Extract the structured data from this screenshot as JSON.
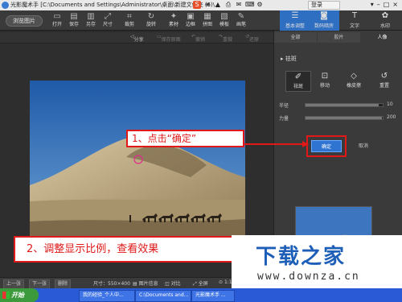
{
  "window": {
    "title": "光影魔术手  [C:\\Documents and Settings\\Administrator\\桌面\\新建文件夹 (6)\\...",
    "login_label": "登录"
  },
  "toolbar": {
    "browse_label": "浏览图片",
    "tools": [
      {
        "label": "打开",
        "icon": "folder-icon"
      },
      {
        "label": "保存",
        "icon": "save-icon"
      },
      {
        "label": "另存",
        "icon": "save-as-icon"
      },
      {
        "label": "尺寸",
        "icon": "resize-icon"
      },
      {
        "label": "裁剪",
        "icon": "crop-icon"
      },
      {
        "label": "旋转",
        "icon": "rotate-icon"
      },
      {
        "label": "素材",
        "icon": "material-icon"
      },
      {
        "label": "边框",
        "icon": "frame-icon"
      },
      {
        "label": "拼图",
        "icon": "collage-icon"
      },
      {
        "label": "模板",
        "icon": "template-icon"
      },
      {
        "label": "画笔",
        "icon": "brush-icon"
      }
    ],
    "right_tabs": [
      {
        "label": "基本调整",
        "icon": "adjust-icon"
      },
      {
        "label": "数码暗房",
        "icon": "camera-icon"
      },
      {
        "label": "文字",
        "icon": "text-icon"
      },
      {
        "label": "水印",
        "icon": "watermark-icon"
      }
    ]
  },
  "subbar": {
    "share": "分享",
    "save_in_place": "保存原图",
    "undo": "撤销",
    "redo": "重做",
    "restore": "还原"
  },
  "panel": {
    "tabs": [
      "全部",
      "胶片",
      "人像"
    ],
    "section_title": "祛斑",
    "tools": [
      {
        "label": "祛斑",
        "icon": "spot-icon"
      },
      {
        "label": "移动",
        "icon": "move-icon"
      },
      {
        "label": "橡皮擦",
        "icon": "eraser-icon"
      },
      {
        "label": "重置",
        "icon": "reset-icon"
      }
    ],
    "sliders": [
      {
        "label": "半径",
        "value": "10",
        "fraction": 0.95
      },
      {
        "label": "力量",
        "value": "200",
        "fraction": 0.99
      }
    ],
    "ok_label": "确定",
    "cancel_label": "取消"
  },
  "annotations": {
    "step1": "1、点击“确定”",
    "step2": "2、调整显示比例，查看效果"
  },
  "statusbar": {
    "prev": "上一张",
    "next": "下一张",
    "delete": "删除",
    "size": "尺寸：550×400",
    "info": "图片信息",
    "compare": "对比",
    "fullscreen": "全屏",
    "zoom_value": "1:1"
  },
  "taskbar": {
    "start": "开始",
    "tasks": [
      "我的经验_个人中...",
      "C:\\Documents and...",
      "光影魔术手 ..."
    ]
  },
  "watermark": {
    "logo_text": "下载之家",
    "url": "www.downza.cn"
  },
  "colors": {
    "accent": "#2f74d0",
    "annotation_red": "#e01818"
  }
}
